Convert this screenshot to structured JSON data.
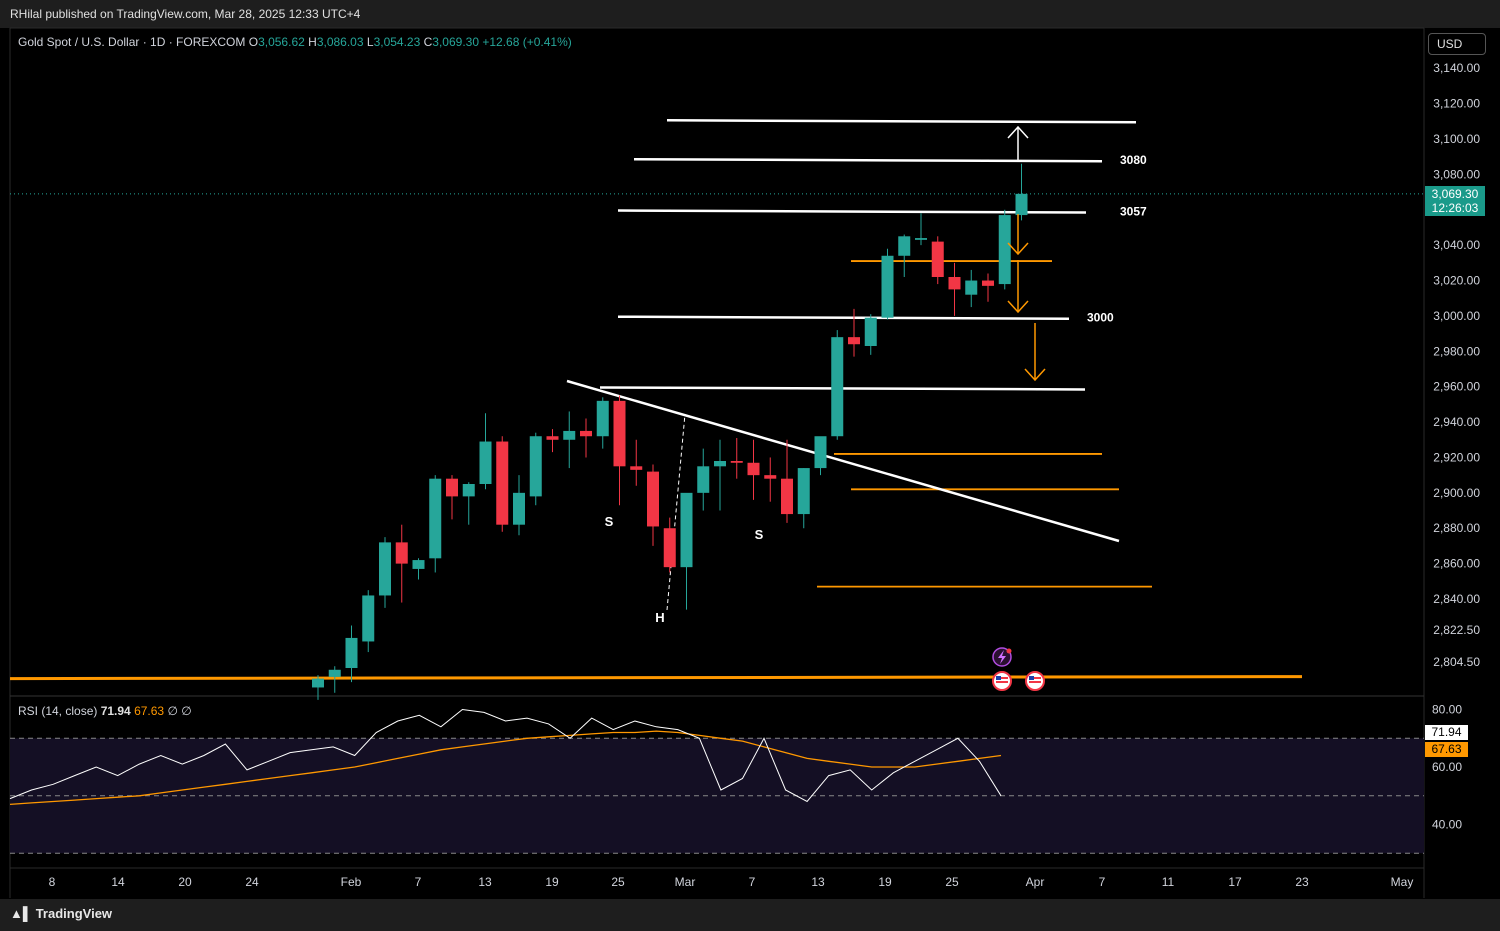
{
  "header": {
    "publisher": "RHilal published on TradingView.com, Mar 28, 2025 12:33 UTC+4",
    "symbol": "Gold Spot / U.S. Dollar · 1D · FOREXCOM",
    "ohlc": {
      "o_label": "O",
      "o": "3,056.62",
      "h_label": "H",
      "h": "3,086.03",
      "l_label": "L",
      "l": "3,054.23",
      "c_label": "C",
      "c": "3,069.30",
      "change": "+12.68 (+0.41%)"
    },
    "currency": "USD"
  },
  "price_tag": {
    "price": "3,069.30",
    "countdown": "12:26:03"
  },
  "footer": {
    "brand": "TradingView"
  },
  "colors": {
    "up": "#26a69a",
    "down": "#f23645",
    "orange": "#ff9800",
    "white_line": "#ffffff",
    "rsi": "#ffffff",
    "rsi_ma": "#ff9800",
    "background": "#000000"
  },
  "chart_data": {
    "type": "candlestick",
    "price_axis": {
      "ticks": [
        "3,140.00",
        "3,120.00",
        "3,100.00",
        "3,080.00",
        "3,040.00",
        "3,020.00",
        "3,000.00",
        "2,980.00",
        "2,960.00",
        "2,940.00",
        "2,920.00",
        "2,900.00",
        "2,880.00",
        "2,860.00",
        "2,840.00",
        "2,822.50",
        "2,804.50"
      ],
      "range": [
        2795,
        3150
      ]
    },
    "time_axis": [
      "8",
      "14",
      "20",
      "24",
      "Feb",
      "7",
      "13",
      "19",
      "25",
      "Mar",
      "7",
      "13",
      "19",
      "25",
      "Apr",
      "7",
      "11",
      "17",
      "23",
      "May"
    ],
    "candles": [
      [
        2790,
        2797,
        2783,
        2795
      ],
      [
        2796,
        2802,
        2787,
        2800
      ],
      [
        2801,
        2825,
        2793,
        2818
      ],
      [
        2816,
        2845,
        2810,
        2842
      ],
      [
        2842,
        2875,
        2835,
        2872
      ],
      [
        2872,
        2882,
        2838,
        2860
      ],
      [
        2857,
        2863,
        2851,
        2862
      ],
      [
        2863,
        2910,
        2855,
        2908
      ],
      [
        2908,
        2910,
        2885,
        2898
      ],
      [
        2898,
        2906,
        2882,
        2905
      ],
      [
        2905,
        2945,
        2902,
        2929
      ],
      [
        2929,
        2932,
        2878,
        2882
      ],
      [
        2882,
        2910,
        2876,
        2900
      ],
      [
        2898,
        2934,
        2893,
        2932
      ],
      [
        2932,
        2936,
        2923,
        2930
      ],
      [
        2930,
        2946,
        2914,
        2935
      ],
      [
        2935,
        2942,
        2920,
        2932
      ],
      [
        2932,
        2954,
        2925,
        2952
      ],
      [
        2952,
        2955,
        2893,
        2915
      ],
      [
        2915,
        2930,
        2904,
        2913
      ],
      [
        2912,
        2916,
        2870,
        2881
      ],
      [
        2880,
        2886,
        2855,
        2858
      ],
      [
        2858,
        2895,
        2834,
        2900
      ],
      [
        2900,
        2925,
        2890,
        2915
      ],
      [
        2915,
        2930,
        2890,
        2918
      ],
      [
        2918,
        2931,
        2908,
        2917
      ],
      [
        2917,
        2930,
        2896,
        2910
      ],
      [
        2910,
        2920,
        2895,
        2908
      ],
      [
        2908,
        2930,
        2883,
        2888
      ],
      [
        2888,
        2914,
        2880,
        2914
      ],
      [
        2914,
        2930,
        2910,
        2932
      ],
      [
        2932,
        2992,
        2930,
        2988
      ],
      [
        2988,
        3004,
        2977,
        2984
      ],
      [
        2983,
        3001,
        2978,
        2999
      ],
      [
        2999,
        3038,
        2998,
        3034
      ],
      [
        3034,
        3046,
        3022,
        3045
      ],
      [
        3043,
        3058,
        3040,
        3044
      ],
      [
        3042,
        3045,
        3018,
        3022
      ],
      [
        3022,
        3030,
        3000,
        3015
      ],
      [
        3012,
        3026,
        3005,
        3020
      ],
      [
        3020,
        3024,
        3008,
        3017
      ],
      [
        3018,
        3060,
        3015,
        3057
      ],
      [
        3057,
        3086,
        3054,
        3069
      ]
    ],
    "levels_white": [
      {
        "price": 3110,
        "label": ""
      },
      {
        "price": 3088,
        "label": "3080"
      },
      {
        "price": 3059,
        "label": "3057"
      },
      {
        "price": 2999,
        "label": "3000"
      },
      {
        "price": 2959,
        "label": ""
      }
    ],
    "levels_orange": [
      3031,
      2922,
      2902,
      2847,
      2795
    ],
    "trendline": {
      "from": [
        2962,
        "Feb 20"
      ],
      "to": [
        2872,
        "Apr 7"
      ]
    },
    "pattern_labels": [
      "S",
      "H",
      "S"
    ],
    "rsi": {
      "label": "RSI (14, close)",
      "value": "71.94",
      "ma_value": "67.63",
      "extra": "∅ ∅",
      "ticks": [
        "80.00",
        "60.00",
        "40.00"
      ],
      "range": [
        30,
        84
      ],
      "values": [
        49,
        52,
        54,
        57,
        60,
        57,
        61,
        64,
        61,
        64,
        68,
        59,
        62,
        65,
        66,
        67,
        64,
        72,
        76,
        78,
        74,
        80,
        79,
        76,
        77,
        75,
        70,
        77,
        73,
        76,
        74,
        73,
        70,
        52,
        56,
        70,
        52,
        48,
        57,
        59,
        52,
        58,
        62,
        66,
        70,
        62,
        50
      ],
      "ma": [
        47,
        47.5,
        48,
        48.5,
        49,
        49.5,
        50,
        51,
        52,
        53,
        54,
        55,
        56,
        57,
        58,
        59,
        60,
        61.5,
        63,
        64.5,
        66,
        67,
        68,
        69,
        70,
        70.5,
        71,
        71.5,
        72,
        72,
        72.5,
        72,
        71,
        70,
        69,
        67,
        65,
        63,
        62,
        61,
        60,
        60,
        60,
        61,
        62,
        63,
        64
      ]
    }
  }
}
